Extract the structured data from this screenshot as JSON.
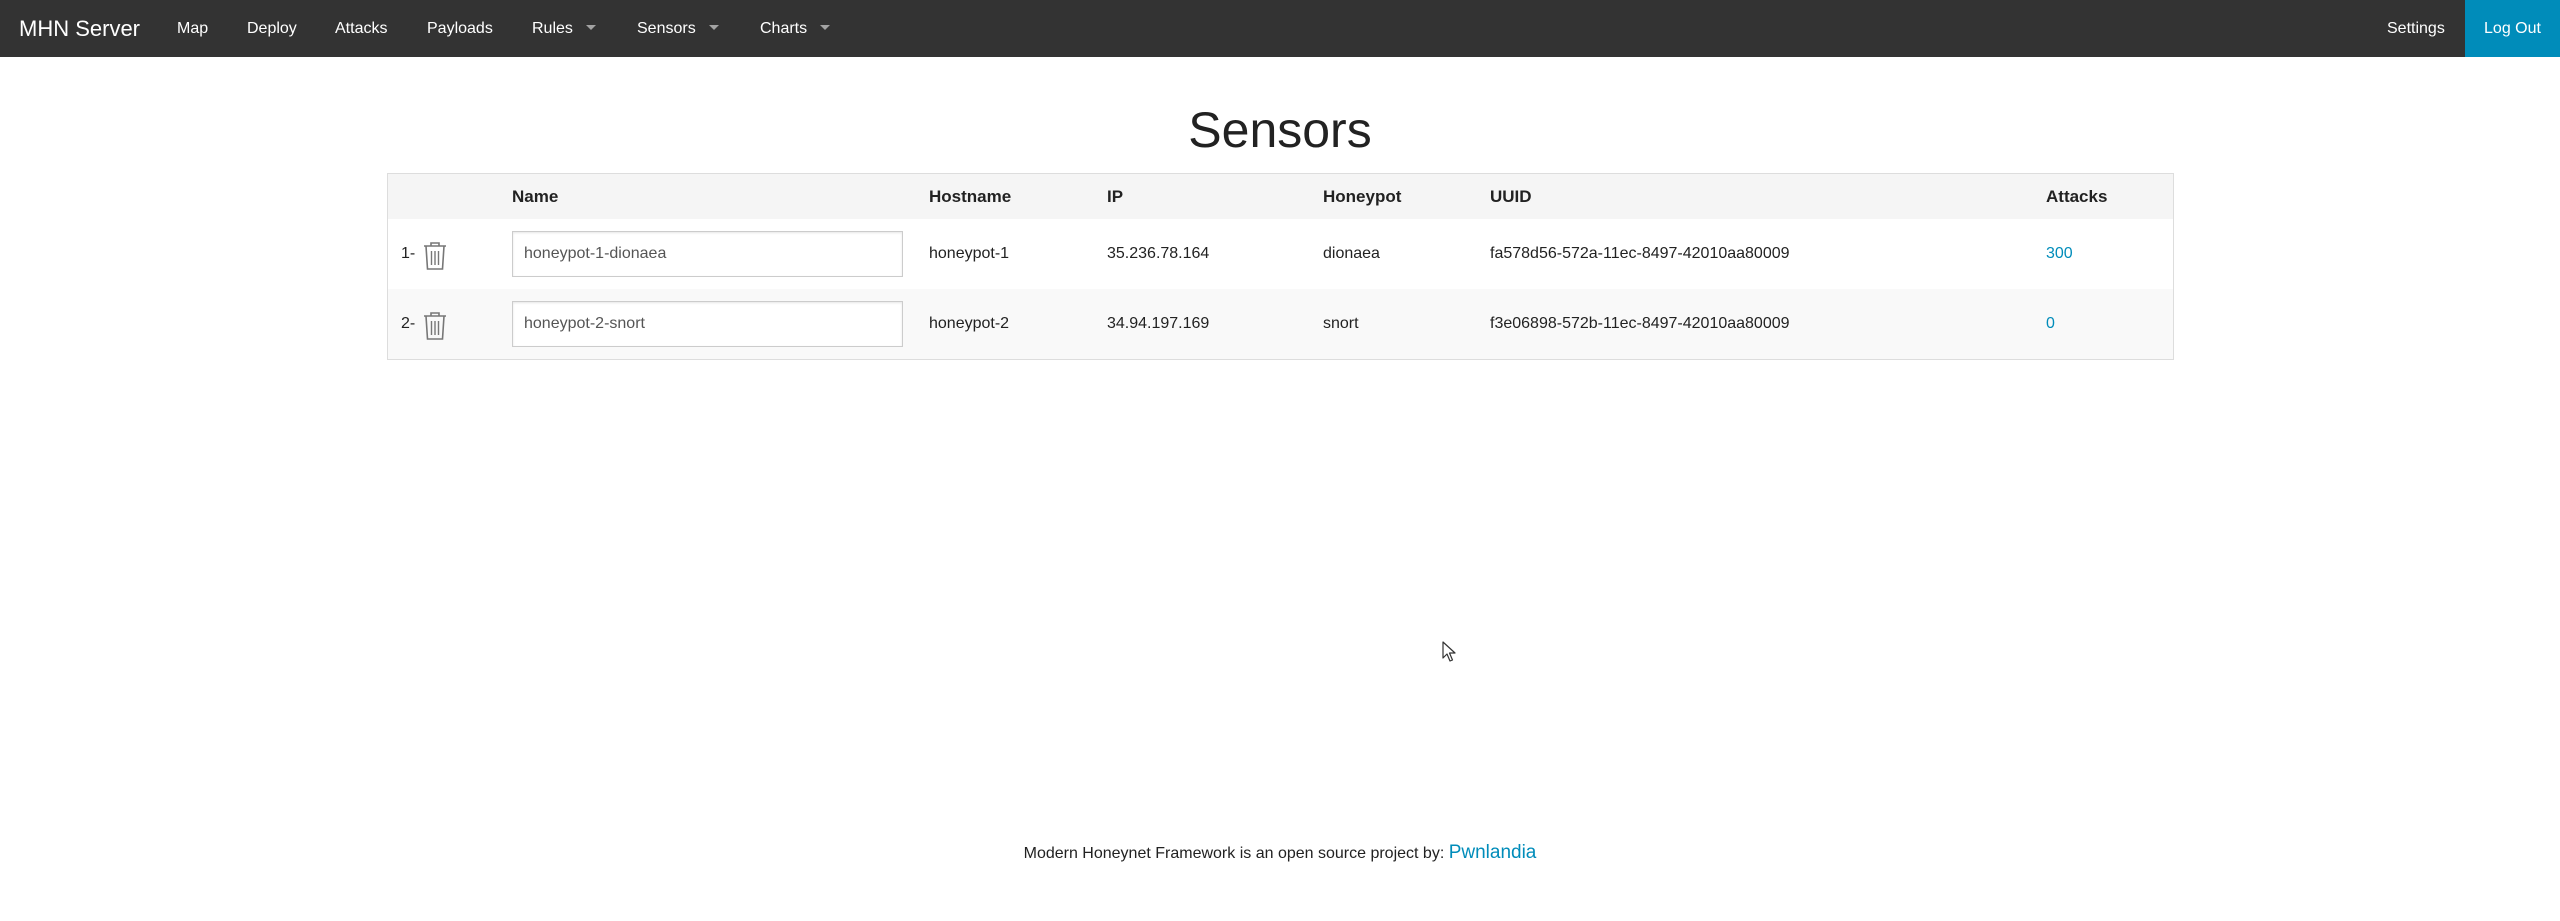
{
  "header": {
    "brand": "MHN Server",
    "nav": [
      {
        "label": "Map"
      },
      {
        "label": "Deploy"
      },
      {
        "label": "Attacks"
      },
      {
        "label": "Payloads"
      },
      {
        "label": "Rules",
        "dropdown": true
      },
      {
        "label": "Sensors",
        "dropdown": true
      },
      {
        "label": "Charts",
        "dropdown": true
      }
    ],
    "settings_label": "Settings",
    "logout_label": "Log Out"
  },
  "page": {
    "title": "Sensors"
  },
  "table": {
    "columns": [
      "Name",
      "Hostname",
      "IP",
      "Honeypot",
      "UUID",
      "Attacks"
    ],
    "rows": [
      {
        "index": "1-",
        "name": "honeypot-1-dionaea",
        "hostname": "honeypot-1",
        "ip": "35.236.78.164",
        "honeypot": "dionaea",
        "uuid": "fa578d56-572a-11ec-8497-42010aa80009",
        "attacks": "300"
      },
      {
        "index": "2-",
        "name": "honeypot-2-snort",
        "hostname": "honeypot-2",
        "ip": "34.94.197.169",
        "honeypot": "snort",
        "uuid": "f3e06898-572b-11ec-8497-42010aa80009",
        "attacks": "0"
      }
    ]
  },
  "footer": {
    "text": "Modern Honeynet Framework is an open source project by: ",
    "link_label": "Pwnlandia"
  },
  "colors": {
    "navbar": "#333333",
    "accent": "#008cba",
    "table_header": "#f5f5f5",
    "table_stripe": "#f9f9f9"
  },
  "icons": [
    "trash-icon",
    "caret-down-icon",
    "mouse-cursor-icon"
  ]
}
